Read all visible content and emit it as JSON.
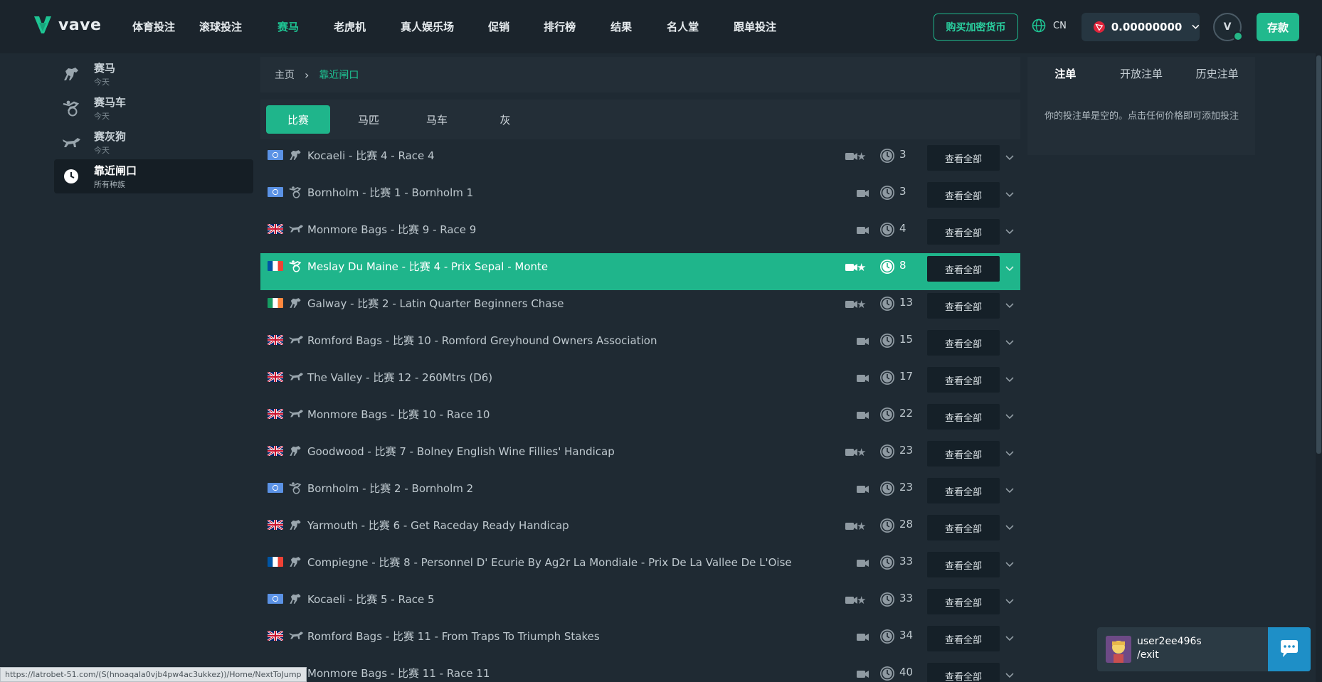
{
  "brand": {
    "name": "vave"
  },
  "nav": {
    "items": [
      {
        "label": "体育投注",
        "active": false
      },
      {
        "label": "滚球投注",
        "active": false
      },
      {
        "label": "赛马",
        "active": true
      },
      {
        "label": "老虎机",
        "active": false
      },
      {
        "label": "真人娱乐场",
        "active": false
      },
      {
        "label": "促销",
        "active": false
      },
      {
        "label": "排行榜",
        "active": false
      },
      {
        "label": "结果",
        "active": false
      },
      {
        "label": "名人堂",
        "active": false
      },
      {
        "label": "跟单投注",
        "active": false
      }
    ],
    "buy_crypto": "购买加密货币",
    "lang": "CN",
    "balance": "0.00000000",
    "avatar_letter": "V",
    "deposit": "存款"
  },
  "sidebar": {
    "items": [
      {
        "title": "赛马",
        "sub": "今天",
        "icon": "horse-icon",
        "active": false
      },
      {
        "title": "赛马车",
        "sub": "今天",
        "icon": "harness-icon",
        "active": false
      },
      {
        "title": "赛灰狗",
        "sub": "今天",
        "icon": "greyhound-icon",
        "active": false
      },
      {
        "title": "靠近闸口",
        "sub": "所有种族",
        "icon": "clock-icon",
        "active": true
      }
    ]
  },
  "breadcrumb": {
    "home": "主页",
    "current": "靠近闸口"
  },
  "tabs": [
    {
      "label": "比赛",
      "active": true
    },
    {
      "label": "马匹",
      "active": false
    },
    {
      "label": "马车",
      "active": false
    },
    {
      "label": "灰",
      "active": false
    }
  ],
  "view_all_label": "查看全部",
  "races": [
    {
      "flag": "un",
      "type": "horse",
      "name": "Kocaeli - 比赛 4 - Race 4",
      "star": true,
      "mins": "3",
      "highlight": false
    },
    {
      "flag": "un",
      "type": "harness",
      "name": "Bornholm - 比赛 1 - Bornholm 1",
      "star": false,
      "mins": "3",
      "highlight": false
    },
    {
      "flag": "uk",
      "type": "greyhound",
      "name": "Monmore Bags - 比赛 9 - Race 9",
      "star": false,
      "mins": "4",
      "highlight": false
    },
    {
      "flag": "fr",
      "type": "harness",
      "name": "Meslay Du Maine - 比赛 4 - Prix Sepal - Monte",
      "star": true,
      "mins": "8",
      "highlight": true
    },
    {
      "flag": "ie",
      "type": "horse",
      "name": "Galway - 比赛 2 - Latin Quarter Beginners Chase",
      "star": true,
      "mins": "13",
      "highlight": false
    },
    {
      "flag": "uk",
      "type": "greyhound",
      "name": "Romford Bags - 比赛 10 - Romford Greyhound Owners Association",
      "star": false,
      "mins": "15",
      "highlight": false
    },
    {
      "flag": "uk",
      "type": "greyhound",
      "name": "The Valley - 比赛 12 - 260Mtrs (D6)",
      "star": false,
      "mins": "17",
      "highlight": false
    },
    {
      "flag": "uk",
      "type": "greyhound",
      "name": "Monmore Bags - 比赛 10 - Race 10",
      "star": false,
      "mins": "22",
      "highlight": false
    },
    {
      "flag": "uk",
      "type": "horse",
      "name": "Goodwood - 比赛 7 - Bolney English Wine Fillies' Handicap",
      "star": true,
      "mins": "23",
      "highlight": false
    },
    {
      "flag": "un",
      "type": "harness",
      "name": "Bornholm - 比赛 2 - Bornholm 2",
      "star": false,
      "mins": "23",
      "highlight": false
    },
    {
      "flag": "uk",
      "type": "horse",
      "name": "Yarmouth - 比赛 6 - Get Raceday Ready Handicap",
      "star": true,
      "mins": "28",
      "highlight": false
    },
    {
      "flag": "fr",
      "type": "horse",
      "name": "Compiegne - 比赛 8 - Personnel D' Ecurie By Ag2r La Mondiale - Prix De La Vallee De L'Oise",
      "star": false,
      "mins": "33",
      "highlight": false
    },
    {
      "flag": "un",
      "type": "horse",
      "name": "Kocaeli - 比赛 5 - Race 5",
      "star": true,
      "mins": "33",
      "highlight": false
    },
    {
      "flag": "uk",
      "type": "greyhound",
      "name": "Romford Bags - 比赛 11 - From Traps To Triumph Stakes",
      "star": false,
      "mins": "34",
      "highlight": false
    },
    {
      "flag": "uk",
      "type": "greyhound",
      "name": "Monmore Bags - 比赛 11 - Race 11",
      "star": false,
      "mins": "40",
      "highlight": false
    }
  ],
  "betslip": {
    "tabs": [
      "注单",
      "开放注单",
      "历史注单"
    ],
    "empty": "你的投注单是空的。点击任何价格即可添加投注"
  },
  "status_url": "https://latrobet-51.com/(S(hnoaqala0vjb4pw4ac3ukkez))/Home/NextToJump",
  "chat": {
    "user": "user2ee496s",
    "command": "/exit"
  },
  "colors": {
    "accent": "#1fb58b",
    "background": "#1f2a33",
    "header": "#1b242c"
  }
}
